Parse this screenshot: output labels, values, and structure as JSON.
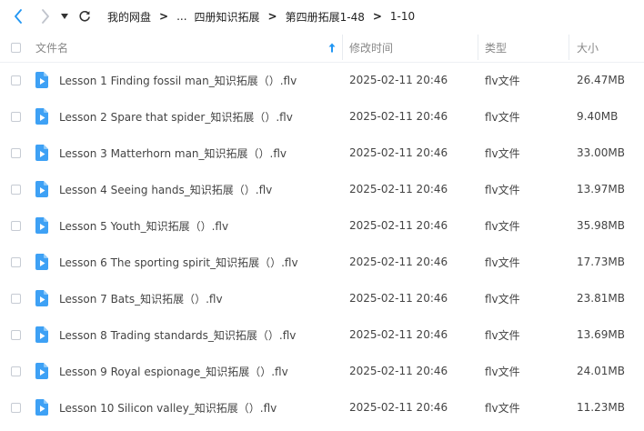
{
  "breadcrumb": {
    "items": [
      "我的网盘",
      "...",
      "四册知识拓展",
      "第四册拓展1-48",
      "1-10"
    ]
  },
  "table": {
    "headers": {
      "name": "文件名",
      "modified": "修改时间",
      "type": "类型",
      "size": "大小"
    },
    "rows": [
      {
        "name": "Lesson 1 Finding fossil man_知识拓展（）.flv",
        "modified": "2025-02-11 20:46",
        "type": "flv文件",
        "size": "26.47MB"
      },
      {
        "name": "Lesson 2 Spare that spider_知识拓展（）.flv",
        "modified": "2025-02-11 20:46",
        "type": "flv文件",
        "size": "9.40MB"
      },
      {
        "name": "Lesson 3 Matterhorn man_知识拓展（）.flv",
        "modified": "2025-02-11 20:46",
        "type": "flv文件",
        "size": "33.00MB"
      },
      {
        "name": "Lesson 4 Seeing hands_知识拓展（）.flv",
        "modified": "2025-02-11 20:46",
        "type": "flv文件",
        "size": "13.97MB"
      },
      {
        "name": "Lesson 5 Youth_知识拓展（）.flv",
        "modified": "2025-02-11 20:46",
        "type": "flv文件",
        "size": "35.98MB"
      },
      {
        "name": "Lesson 6 The sporting spirit_知识拓展（）.flv",
        "modified": "2025-02-11 20:46",
        "type": "flv文件",
        "size": "17.73MB"
      },
      {
        "name": "Lesson 7 Bats_知识拓展（）.flv",
        "modified": "2025-02-11 20:46",
        "type": "flv文件",
        "size": "23.81MB"
      },
      {
        "name": "Lesson 8 Trading standards_知识拓展（）.flv",
        "modified": "2025-02-11 20:46",
        "type": "flv文件",
        "size": "13.69MB"
      },
      {
        "name": "Lesson 9 Royal espionage_知识拓展（）.flv",
        "modified": "2025-02-11 20:46",
        "type": "flv文件",
        "size": "24.01MB"
      },
      {
        "name": "Lesson 10 Silicon valley_知识拓展（）.flv",
        "modified": "2025-02-11 20:46",
        "type": "flv文件",
        "size": "11.23MB"
      }
    ]
  },
  "icons": {
    "back": "chevron-left-icon",
    "forward": "chevron-right-icon",
    "history": "caret-down-icon",
    "refresh": "refresh-icon",
    "sort": "sort-asc-icon",
    "file": "video-file-icon"
  },
  "colors": {
    "accent": "#2196f3",
    "file_icon": "#3ea1f5",
    "nav_disabled": "#c0c4cc"
  }
}
